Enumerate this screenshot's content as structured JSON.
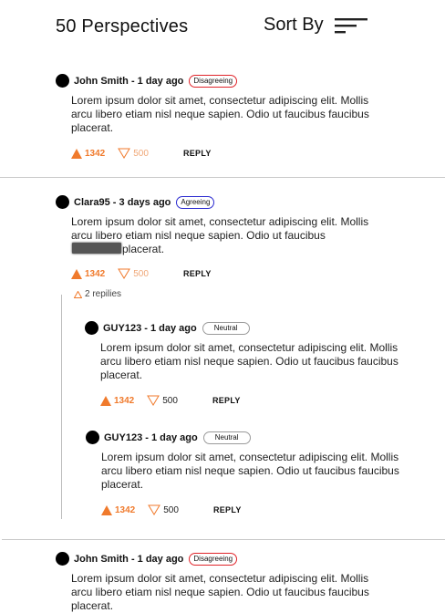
{
  "header": {
    "title": "50 Perspectives",
    "sort_label": "Sort By",
    "sort_icon": "sort-lines-icon"
  },
  "comments": [
    {
      "author": "John Smith - 1 day ago",
      "stance": "Disagreeing",
      "body": "Lorem ipsum dolor sit amet, consectetur adipiscing elit. Mollis arcu libero etiam nisl neque sapien. Odio ut faucibus faucibus placerat.",
      "upvotes": "1342",
      "downvotes": "500",
      "reply": "REPLY"
    },
    {
      "author": "Clara95 - 3 days ago",
      "stance": "Agreeing",
      "body_before": "Lorem ipsum dolor sit amet, consectetur adipiscing elit. Mollis arcu libero etiam nisl neque sapien. Odio ut faucibus",
      "body_after": "placerat.",
      "upvotes": "1342",
      "downvotes": "500",
      "reply": "REPLY",
      "replies_toggle": "2 repilies"
    },
    {
      "author": "GUY123 - 1 day ago",
      "stance": "Neutral",
      "body": "Lorem ipsum dolor sit amet, consectetur adipiscing elit. Mollis arcu libero etiam nisl neque sapien. Odio ut faucibus faucibus placerat.",
      "upvotes": "1342",
      "downvotes": "500",
      "reply": "REPLY"
    },
    {
      "author": "GUY123 - 1 day ago",
      "stance": "Neutral",
      "body": "Lorem ipsum dolor sit amet, consectetur adipiscing elit. Mollis arcu libero etiam nisl neque sapien. Odio ut faucibus faucibus placerat.",
      "upvotes": "1342",
      "downvotes": "500",
      "reply": "REPLY"
    },
    {
      "author": "John Smith - 1 day ago",
      "stance": "Disagreeing",
      "body": "Lorem ipsum dolor sit amet, consectetur adipiscing elit. Mollis arcu libero etiam nisl neque sapien. Odio ut faucibus faucibus placerat."
    }
  ],
  "colors": {
    "upvote": "#f07a2c",
    "disagree": "#e0242a",
    "agree": "#2a2ad0",
    "neutral": "#9a9a9a"
  }
}
